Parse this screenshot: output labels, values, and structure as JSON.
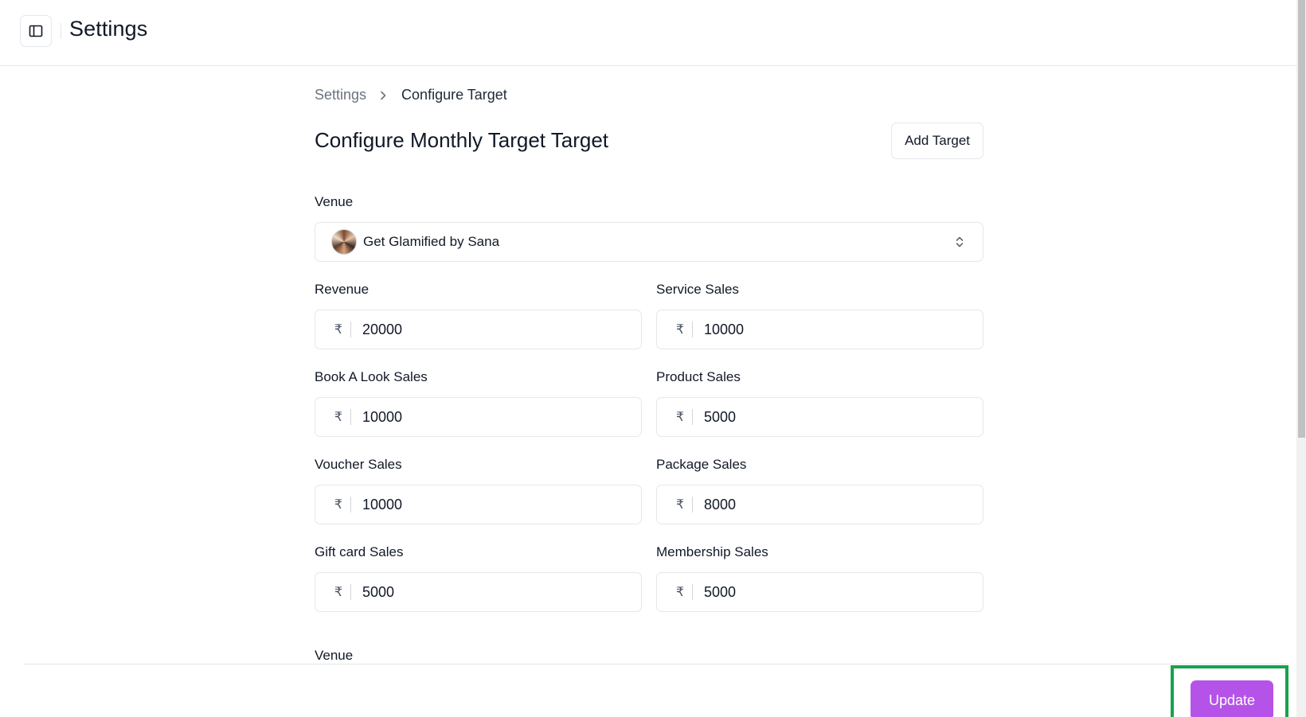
{
  "header": {
    "title": "Settings",
    "sidebar_toggle_icon": "sidebar-toggle-icon"
  },
  "breadcrumb": {
    "root": "Settings",
    "current": "Configure Target"
  },
  "page": {
    "title": "Configure Monthly Target Target",
    "add_target_label": "Add Target"
  },
  "venue": {
    "label": "Venue",
    "selected": "Get Glamified by Sana"
  },
  "currency_symbol": "₹",
  "fields": [
    {
      "label": "Revenue",
      "value": "20000"
    },
    {
      "label": "Service Sales",
      "value": "10000"
    },
    {
      "label": "Book A Look Sales",
      "value": "10000"
    },
    {
      "label": "Product Sales",
      "value": "5000"
    },
    {
      "label": "Voucher Sales",
      "value": "10000"
    },
    {
      "label": "Package Sales",
      "value": "8000"
    },
    {
      "label": "Gift card Sales",
      "value": "5000"
    },
    {
      "label": "Membership Sales",
      "value": "5000"
    }
  ],
  "second_venue": {
    "label": "Venue"
  },
  "footer": {
    "update_label": "Update"
  },
  "colors": {
    "accent": "#b553e8",
    "highlight": "#16a34a"
  }
}
